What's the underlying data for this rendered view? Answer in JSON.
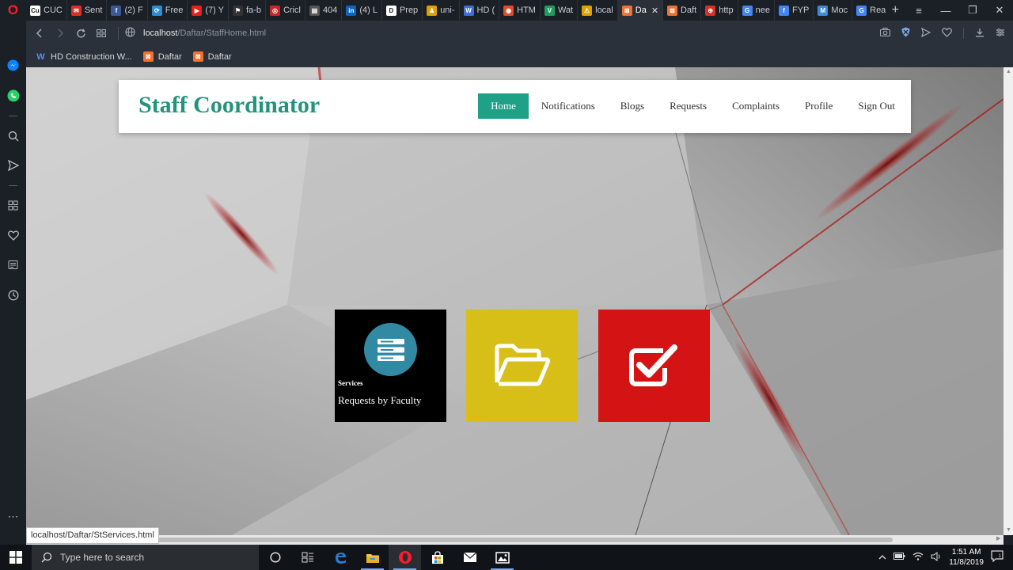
{
  "browser": {
    "tabs": [
      {
        "label": "CUC",
        "icon": "cuc-icon",
        "color": "#ffffff",
        "glyph": "Cu"
      },
      {
        "label": "Sent",
        "icon": "gmail-icon",
        "color": "#d93025",
        "glyph": "✉"
      },
      {
        "label": "(2) F",
        "icon": "facebook-icon",
        "color": "#3b5998",
        "glyph": "f"
      },
      {
        "label": "Free",
        "icon": "free-icon",
        "color": "#2b8dd6",
        "glyph": "⟳"
      },
      {
        "label": "(7) Y",
        "icon": "youtube-icon",
        "color": "#e62117",
        "glyph": "▶"
      },
      {
        "label": "fa-b",
        "icon": "flag-icon",
        "color": "#333333",
        "glyph": "⚑"
      },
      {
        "label": "Cricl",
        "icon": "cricket-icon",
        "color": "#c62828",
        "glyph": "◎"
      },
      {
        "label": "404",
        "icon": "page-icon",
        "color": "#555555",
        "glyph": "▤"
      },
      {
        "label": "(4) L",
        "icon": "linkedin-icon",
        "color": "#0a66c2",
        "glyph": "in"
      },
      {
        "label": "Prep",
        "icon": "prep-icon",
        "color": "#ffffff",
        "glyph": "D"
      },
      {
        "label": "uni-",
        "icon": "uni-icon",
        "color": "#e0a000",
        "glyph": "♟"
      },
      {
        "label": "HD (",
        "icon": "hd-icon",
        "color": "#3c6fd8",
        "glyph": "W"
      },
      {
        "label": "HTM",
        "icon": "html-icon",
        "color": "#e04a2a",
        "glyph": "◉"
      },
      {
        "label": "Wat",
        "icon": "wattpad-icon",
        "color": "#1e9e5e",
        "glyph": "V"
      },
      {
        "label": "local",
        "icon": "xampp-icon",
        "color": "#e0a000",
        "glyph": "⚠"
      },
      {
        "label": "Da",
        "icon": "xampp-icon",
        "color": "#f0712e",
        "glyph": "⊠",
        "active": true
      },
      {
        "label": "Daft",
        "icon": "xampp-icon",
        "color": "#f0712e",
        "glyph": "⊠"
      },
      {
        "label": "http",
        "icon": "http-icon",
        "color": "#d93025",
        "glyph": "⊕"
      },
      {
        "label": "nee",
        "icon": "google-icon",
        "color": "#4285f4",
        "glyph": "G"
      },
      {
        "label": "FYP",
        "icon": "fyp-icon",
        "color": "#4285f4",
        "glyph": "f"
      },
      {
        "label": "Moc",
        "icon": "moc-icon",
        "color": "#3c8bd9",
        "glyph": "M"
      },
      {
        "label": "Real",
        "icon": "google-icon",
        "color": "#4285f4",
        "glyph": "G"
      }
    ],
    "address": {
      "host": "localhost",
      "path": "/Daftar/StaffHome.html"
    },
    "bookmarks": [
      {
        "label": "HD Construction W...",
        "icon": "wp-icon"
      },
      {
        "label": "Daftar",
        "icon": "xampp-icon"
      },
      {
        "label": "Daftar",
        "icon": "xampp-icon"
      }
    ],
    "status_url": "localhost/Daftar/StServices.html"
  },
  "site": {
    "brand": "Staff Coordinator",
    "nav": [
      {
        "label": "Home",
        "active": true
      },
      {
        "label": "Notifications"
      },
      {
        "label": "Blogs"
      },
      {
        "label": "Requests"
      },
      {
        "label": "Complaints"
      },
      {
        "label": "Profile"
      },
      {
        "label": "Sign Out"
      }
    ],
    "tiles": [
      {
        "subtitle": "Services",
        "title": "Requests by Faculty",
        "icon": "server-icon",
        "color": "#000000",
        "icon_bg": "#3189a4"
      },
      {
        "icon": "folder-open-icon",
        "color": "#d8bf18"
      },
      {
        "icon": "checkbox-icon",
        "color": "#d41414"
      }
    ],
    "accent": "#1fa188",
    "brand_color": "#22947b"
  },
  "taskbar": {
    "search_placeholder": "Type here to search",
    "time": "1:51 AM",
    "date": "11/8/2019"
  }
}
